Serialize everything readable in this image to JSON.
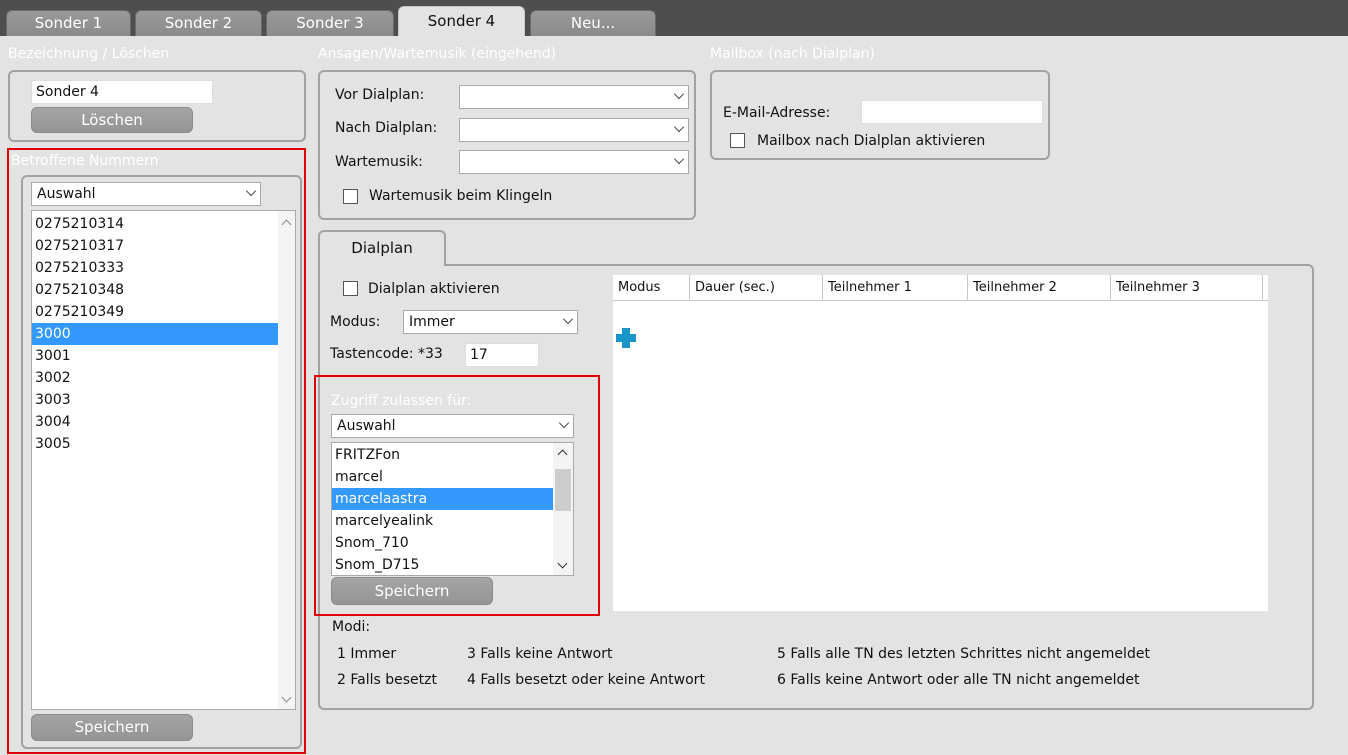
{
  "tabs": [
    {
      "label": "Sonder 1",
      "active": false
    },
    {
      "label": "Sonder 2",
      "active": false
    },
    {
      "label": "Sonder 3",
      "active": false
    },
    {
      "label": "Sonder 4",
      "active": true
    },
    {
      "label": "Neu...",
      "active": false
    }
  ],
  "bezeichnung": {
    "legend": "Bezeichnung / Löschen",
    "name_value": "Sonder 4",
    "delete_label": "Löschen"
  },
  "ansagen": {
    "legend": "Ansagen/Wartemusik (eingehend)",
    "vor_label": "Vor Dialplan:",
    "vor_value": "",
    "nach_label": "Nach Dialplan:",
    "nach_value": "",
    "warte_label": "Wartemusik:",
    "warte_value": "",
    "klingeln_label": "Wartemusik beim Klingeln"
  },
  "mailbox": {
    "legend": "Mailbox (nach Dialplan)",
    "email_label": "E-Mail-Adresse:",
    "email_value": "",
    "activate_label": "Mailbox nach Dialplan aktivieren"
  },
  "betroffene": {
    "legend": "Betroffene Nummern",
    "select_value": "Auswahl",
    "numbers": [
      "0275210314",
      "0275210317",
      "0275210333",
      "0275210348",
      "0275210349",
      "3000",
      "3001",
      "3002",
      "3003",
      "3004",
      "3005"
    ],
    "selected": "3000",
    "save_label": "Speichern"
  },
  "dialplan": {
    "tab_label": "Dialplan",
    "activate_label": "Dialplan aktivieren",
    "modus_label": "Modus:",
    "modus_value": "Immer",
    "tastencode_label": "Tastencode: *33",
    "tastencode_value": "17",
    "columns": [
      "Modus",
      "Dauer (sec.)",
      "Teilnehmer 1",
      "Teilnehmer 2",
      "Teilnehmer 3"
    ],
    "add_icon": "plus-icon"
  },
  "zugriff": {
    "legend": "Zugriff zulassen für:",
    "select_value": "Auswahl",
    "users": [
      "FRITZFon",
      "marcel",
      "marcelaastra",
      "marcelyealink",
      "Snom_710",
      "Snom_D715"
    ],
    "selected": "marcelaastra",
    "save_label": "Speichern"
  },
  "modi": {
    "heading": "Modi:",
    "items": [
      "1 Immer",
      "3 Falls keine Antwort",
      "5 Falls alle TN des letzten Schrittes nicht angemeldet",
      "2 Falls besetzt",
      "4 Falls besetzt oder keine Antwort",
      "6 Falls keine Antwort oder alle TN nicht angemeldet"
    ]
  },
  "colors": {
    "tab_bar": "#4e4e4e",
    "panel_bg": "#e3e3e3",
    "selection": "#3399ff",
    "highlight_border": "#e00000",
    "add_icon": "#1a95c8"
  }
}
